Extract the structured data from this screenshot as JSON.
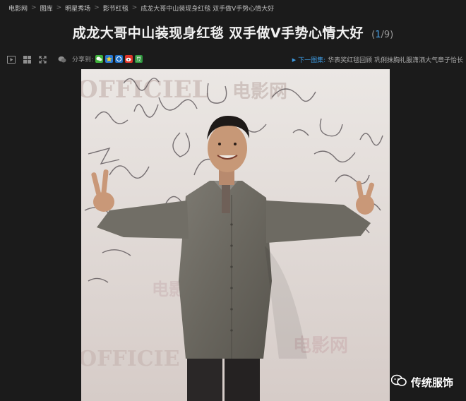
{
  "breadcrumb": {
    "items": [
      "电影网",
      "图库",
      "明星秀场",
      "影节红毯",
      "成龙大哥中山装现身红毯 双手做V手势心情大好"
    ],
    "separator": ">"
  },
  "gallery": {
    "title": "成龙大哥中山装现身红毯 双手做V手势心情大好",
    "counter_open": "(",
    "current": "1",
    "total": "/9",
    "counter_close": ")"
  },
  "toolbar": {
    "icons": [
      "play-icon",
      "grid-icon",
      "fullscreen-icon",
      "comment-icon"
    ]
  },
  "share": {
    "label": "分享到:",
    "services": [
      {
        "name": "wechat-icon",
        "color": "#3fb23b"
      },
      {
        "name": "qzone-icon",
        "color": "#2a7ad6"
      },
      {
        "name": "renren-icon",
        "color": "#1e6fc4"
      },
      {
        "name": "weibo-icon",
        "color": "#e0352b"
      },
      {
        "name": "douban-icon",
        "color": "#2e963d",
        "glyph": "豆"
      }
    ]
  },
  "next_gallery": {
    "label": "下一图集:",
    "titles": "华表奖红毯回顾 巩俐抹胸礼服潇洒大气章子怡长"
  },
  "photo": {
    "alt_subject": "man in grey jacket making V signs in front of signature wall",
    "wall_text": [
      "OFFICIEL",
      "电影网",
      "电影网",
      "OFFICIE",
      "电影网"
    ]
  },
  "watermark": {
    "text": "传统服饰",
    "icon": "wechat-icon"
  }
}
